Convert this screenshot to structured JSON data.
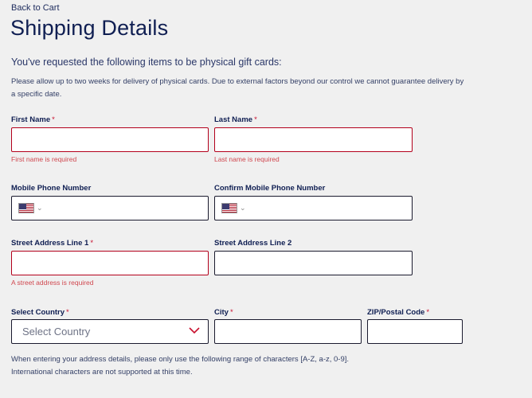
{
  "nav": {
    "back_label": "Back to Cart"
  },
  "page": {
    "title": "Shipping Details",
    "intro": "You've requested the following items to be physical gift cards:",
    "note": "Please allow up to two weeks for delivery of physical cards. Due to external factors beyond our control we cannot guarantee delivery by a specific date."
  },
  "form": {
    "required_marker": "*",
    "first_name": {
      "label": "First Name",
      "value": "",
      "error": "First name is required"
    },
    "last_name": {
      "label": "Last Name",
      "value": "",
      "error": "Last name is required"
    },
    "mobile_phone": {
      "label": "Mobile Phone Number",
      "value": "",
      "country_flag": "us-flag-icon"
    },
    "confirm_mobile_phone": {
      "label": "Confirm Mobile Phone Number",
      "value": "",
      "country_flag": "us-flag-icon"
    },
    "street1": {
      "label": "Street Address Line 1",
      "value": "",
      "error": "A street address is required"
    },
    "street2": {
      "label": "Street Address Line 2",
      "value": ""
    },
    "country": {
      "label": "Select Country",
      "selected": "Select Country"
    },
    "city": {
      "label": "City",
      "value": ""
    },
    "zip": {
      "label": "ZIP/Postal Code",
      "value": ""
    }
  },
  "footer": {
    "line1": "When entering your address details, please only use the following range of characters [A-Z, a-z, 0-9].",
    "line2": "International characters are not supported at this time."
  },
  "colors": {
    "background": "#f0f0f0",
    "heading": "#0f1e52",
    "error_border": "#b3001b",
    "error_text": "#d0474f",
    "required": "#c8102e"
  }
}
